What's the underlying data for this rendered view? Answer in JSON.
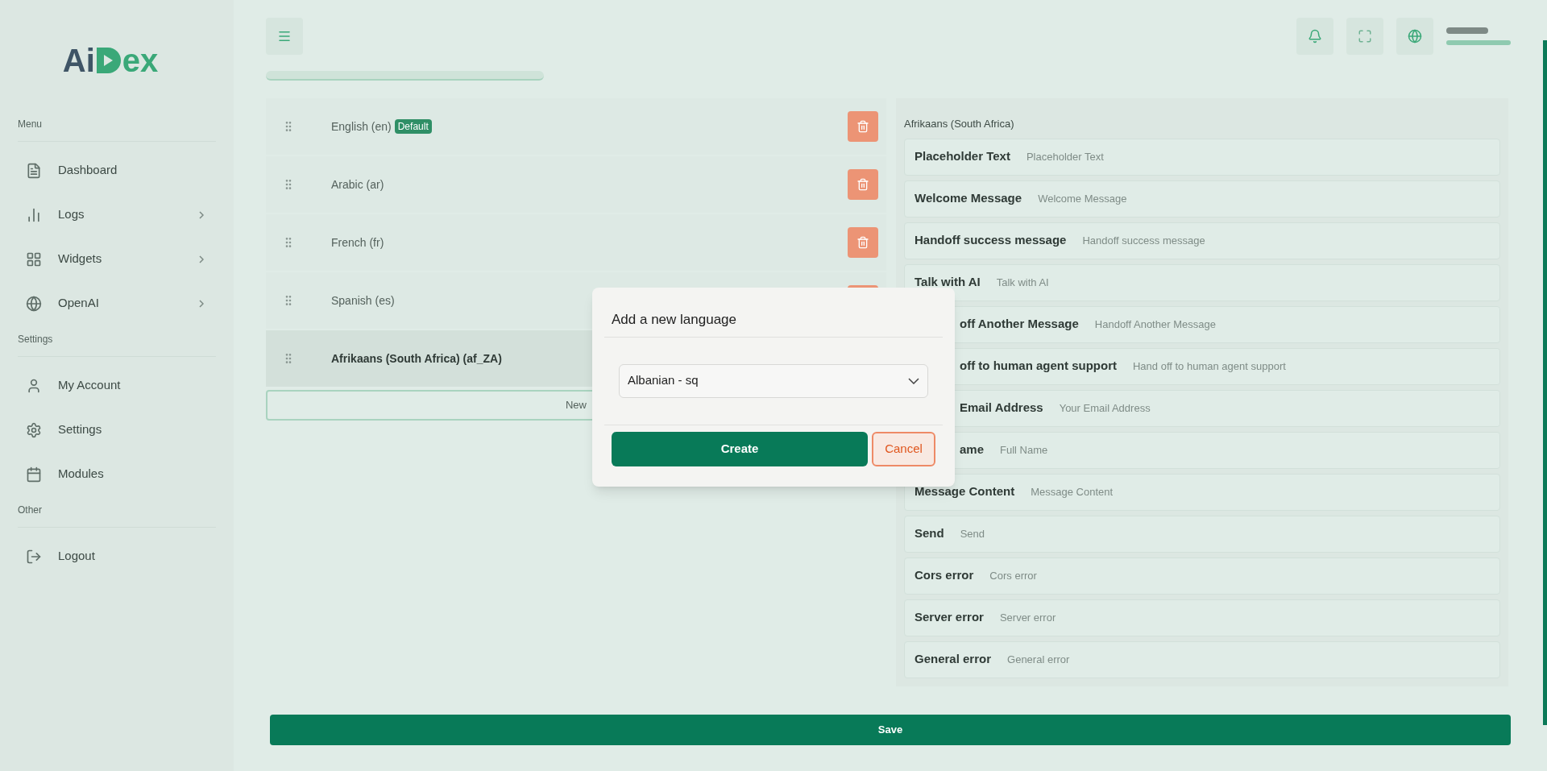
{
  "sidebar": {
    "logo": {
      "part_1": "Ai",
      "part_2": "ex"
    },
    "sections": [
      {
        "label": "Menu",
        "items": [
          {
            "label": "Dashboard",
            "expandable": false
          },
          {
            "label": "Logs",
            "expandable": true
          },
          {
            "label": "Widgets",
            "expandable": true
          },
          {
            "label": "OpenAI",
            "expandable": true
          }
        ]
      },
      {
        "label": "Settings",
        "items": [
          {
            "label": "My Account",
            "expandable": false
          },
          {
            "label": "Settings",
            "expandable": false
          },
          {
            "label": "Modules",
            "expandable": false
          }
        ]
      },
      {
        "label": "Other",
        "items": [
          {
            "label": "Logout",
            "expandable": false
          }
        ]
      }
    ]
  },
  "languages": [
    {
      "label": "English (en)",
      "badge": "Default",
      "selected": false
    },
    {
      "label": "Arabic (ar)",
      "selected": false
    },
    {
      "label": "French (fr)",
      "selected": false
    },
    {
      "label": "Spanish (es)",
      "selected": false
    },
    {
      "label": "Afrikaans (South Africa) (af_ZA)",
      "selected": true
    }
  ],
  "new_button": "New",
  "translation_panel": {
    "title": "Afrikaans (South Africa)",
    "fields": [
      {
        "label": "Placeholder Text",
        "placeholder": "Placeholder Text"
      },
      {
        "label": "Welcome Message",
        "placeholder": "Welcome Message"
      },
      {
        "label": "Handoff success message",
        "placeholder": "Handoff success message"
      },
      {
        "label": "Talk with AI",
        "placeholder": "Talk with AI"
      },
      {
        "label": "off Another Message",
        "placeholder": "Handoff Another Message",
        "kind": "partly_hidden"
      },
      {
        "label": "off to human agent support",
        "placeholder": "Hand off to human agent support",
        "kind": "partly_hidden"
      },
      {
        "label": "Email Address",
        "placeholder": "Your Email Address",
        "kind": "partly_hidden"
      },
      {
        "label": "ame",
        "placeholder": "Full Name",
        "kind": "partly_hidden"
      },
      {
        "label": "Message Content",
        "placeholder": "Message Content"
      },
      {
        "label": "Send",
        "placeholder": "Send"
      },
      {
        "label": "Cors error",
        "placeholder": "Cors error"
      },
      {
        "label": "Server error",
        "placeholder": "Server error"
      },
      {
        "label": "General error",
        "placeholder": "General error"
      }
    ]
  },
  "save_button": "Save",
  "dialog": {
    "title": "Add a new language",
    "select_value": "Albanian - sq",
    "buttons": [
      {
        "label": "Create",
        "kind": "primary"
      },
      {
        "label": "Cancel",
        "kind": "secondary"
      }
    ]
  }
}
